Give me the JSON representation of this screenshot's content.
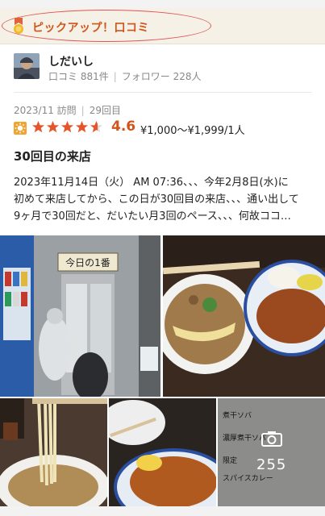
{
  "pickup": {
    "label": "ピックアップ！口コミ"
  },
  "user": {
    "name": "しだいし",
    "reviews": "口コミ 881件",
    "followers": "フォロワー 228人"
  },
  "visit": {
    "date": "2023/11 訪問",
    "count": "29回目"
  },
  "rating": {
    "score": "4.6",
    "stars": 4.6,
    "price": "¥1,000～¥1,999/1人"
  },
  "review": {
    "title": "30回目の来店",
    "lines": [
      "2023年11月14日（火） AM 07:36、、、今年2月8日(水)に",
      "初めて来店してから、この日が30回目の来店、、、通い出して",
      "9ヶ月で30回だと、だいたい月3回のペース、、、何故ココ…"
    ]
  },
  "photos": {
    "store_sign": "今日の1番",
    "more_count": "255",
    "menu_lines": [
      "煮干ソバ",
      "濃厚煮干ソバ",
      "限定",
      "スパイスカレー"
    ]
  },
  "colors": {
    "accent": "#d2541a",
    "star": "#e8542a",
    "oval": "#e05656"
  }
}
